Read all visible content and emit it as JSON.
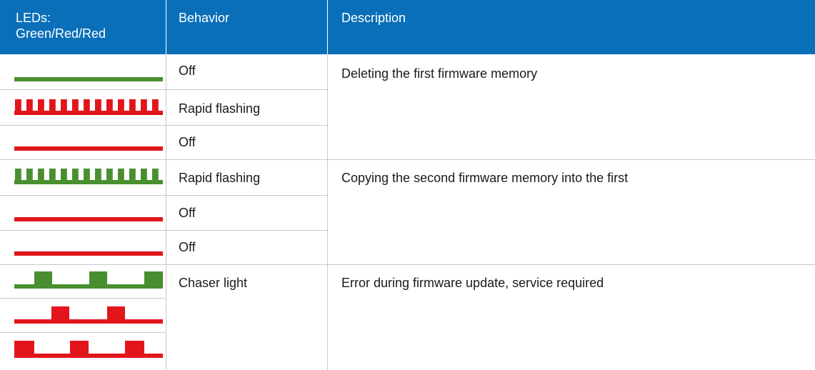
{
  "header": {
    "col1": "LEDs:\nGreen/Red/Red",
    "col2": "Behavior",
    "col3": "Description"
  },
  "colors": {
    "header_bg": "#0a6fb9",
    "green": "#4a8f2f",
    "red": "#e2151b",
    "grid": "#c9c9c9"
  },
  "groups": [
    {
      "description": "Deleting the first firmware memory",
      "rows": [
        {
          "led_color": "green",
          "pattern": "steady-line",
          "behavior": "Off"
        },
        {
          "led_color": "red",
          "pattern": "rapid-flash",
          "behavior": "Rapid flashing"
        },
        {
          "led_color": "red",
          "pattern": "steady-line",
          "behavior": "Off"
        }
      ]
    },
    {
      "description": "Copying the second firmware memory into the first",
      "rows": [
        {
          "led_color": "green",
          "pattern": "rapid-flash",
          "behavior": "Rapid flashing"
        },
        {
          "led_color": "red",
          "pattern": "steady-line",
          "behavior": "Off"
        },
        {
          "led_color": "red",
          "pattern": "steady-line",
          "behavior": "Off"
        }
      ]
    },
    {
      "description": "Error during firmware update, service required",
      "rows": [
        {
          "led_color": "green",
          "pattern": "chaser-phase-1",
          "behavior": "Chaser light"
        },
        {
          "led_color": "red",
          "pattern": "chaser-phase-2",
          "behavior": ""
        },
        {
          "led_color": "red",
          "pattern": "chaser-phase-3",
          "behavior": ""
        }
      ]
    }
  ]
}
